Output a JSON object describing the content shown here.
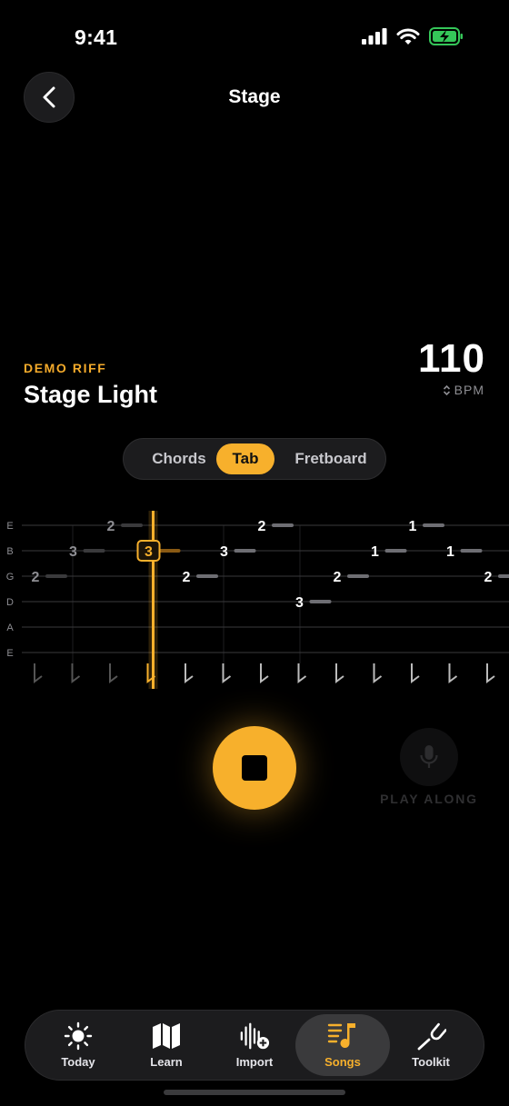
{
  "status_bar": {
    "time": "9:41"
  },
  "header": {
    "title": "Stage",
    "back_icon": "chevron-left-icon"
  },
  "song": {
    "kicker": "DEMO RIFF",
    "title": "Stage Light",
    "bpm": "110",
    "bpm_label": "BPM"
  },
  "view_modes": {
    "options": [
      "Chords",
      "Tab",
      "Fretboard"
    ],
    "selected": "Tab"
  },
  "tab": {
    "strings": [
      "E",
      "B",
      "G",
      "D",
      "A",
      "E"
    ],
    "notes": [
      {
        "string": 2,
        "beat": 0,
        "fret": "2",
        "state": "past"
      },
      {
        "string": 1,
        "beat": 1,
        "fret": "3",
        "state": "past"
      },
      {
        "string": 0,
        "beat": 2,
        "fret": "2",
        "state": "past"
      },
      {
        "string": 1,
        "beat": 3,
        "fret": "3",
        "state": "current"
      },
      {
        "string": 2,
        "beat": 4,
        "fret": "2",
        "state": "upcoming"
      },
      {
        "string": 1,
        "beat": 5,
        "fret": "3",
        "state": "upcoming"
      },
      {
        "string": 0,
        "beat": 6,
        "fret": "2",
        "state": "upcoming"
      },
      {
        "string": 3,
        "beat": 7,
        "fret": "3",
        "state": "upcoming"
      },
      {
        "string": 2,
        "beat": 8,
        "fret": "2",
        "state": "upcoming"
      },
      {
        "string": 1,
        "beat": 9,
        "fret": "1",
        "state": "upcoming"
      },
      {
        "string": 0,
        "beat": 10,
        "fret": "1",
        "state": "upcoming"
      },
      {
        "string": 1,
        "beat": 11,
        "fret": "1",
        "state": "upcoming"
      },
      {
        "string": 2,
        "beat": 12,
        "fret": "2",
        "state": "upcoming"
      }
    ],
    "beats": 13,
    "playhead_beat": 3
  },
  "controls": {
    "stop_icon": "stop-icon",
    "mic_icon": "microphone-icon",
    "play_along_label": "PLAY ALONG"
  },
  "tab_bar": {
    "items": [
      {
        "label": "Today",
        "icon": "sun-icon"
      },
      {
        "label": "Learn",
        "icon": "map-icon"
      },
      {
        "label": "Import",
        "icon": "waveform-plus-icon"
      },
      {
        "label": "Songs",
        "icon": "music-note-list-icon",
        "selected": true
      },
      {
        "label": "Toolkit",
        "icon": "tuning-fork-icon"
      }
    ]
  },
  "colors": {
    "accent": "#f7b02c",
    "background": "#000000",
    "surface": "#1c1c1e"
  }
}
